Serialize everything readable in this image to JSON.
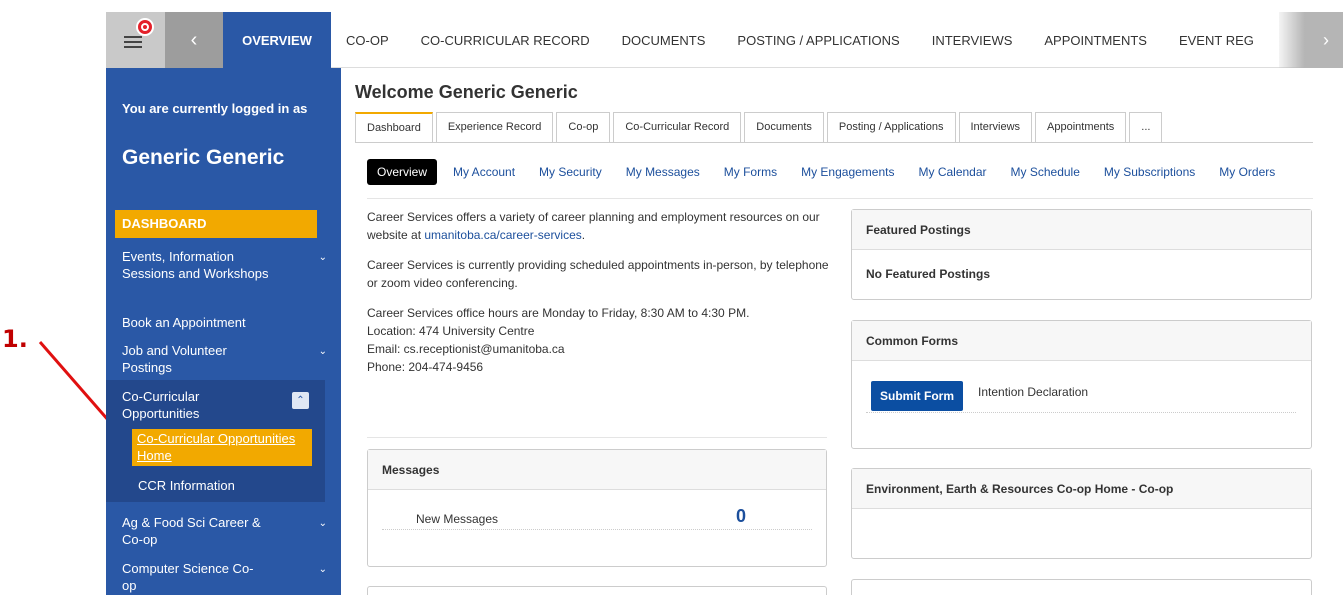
{
  "annotation": {
    "label": "1."
  },
  "topbar": {
    "overview_label": "OVERVIEW",
    "back_glyph": "‹",
    "next_glyph": "›",
    "items": [
      "CO-OP",
      "CO-CURRICULAR RECORD",
      "DOCUMENTS",
      "POSTING / APPLICATIONS",
      "INTERVIEWS",
      "APPOINTMENTS",
      "EVENT REG"
    ]
  },
  "sidebar": {
    "logged_in_text": "You are currently logged in as",
    "user_name": "Generic Generic",
    "dashboard_label": "DASHBOARD",
    "items": [
      "Events, Information Sessions and Workshops",
      "Book an Appointment",
      "Job and Volunteer Postings",
      "Co-Curricular Opportunities",
      "Ag & Food Sci Career & Co-op",
      "Computer Science Co-op"
    ],
    "sub_items": [
      "Co-Curricular Opportunities Home",
      "CCR Information"
    ]
  },
  "main": {
    "welcome": "Welcome Generic Generic",
    "tabs": [
      "Dashboard",
      "Experience Record",
      "Co-op",
      "Co-Curricular Record",
      "Documents",
      "Posting / Applications",
      "Interviews",
      "Appointments",
      "..."
    ],
    "subtabs": [
      "Overview",
      "My Account",
      "My Security",
      "My Messages",
      "My Forms",
      "My Engagements",
      "My Calendar",
      "My Schedule",
      "My Subscriptions",
      "My Orders"
    ],
    "intro": {
      "p1_text": "Career Services offers a variety of career planning and employment resources on our website at ",
      "p1_link": "umanitoba.ca/career-services",
      "p1_end": ".",
      "p2": "Career Services is currently providing scheduled appointments in-person, by telephone or zoom video conferencing.",
      "p3_hours": "Career Services office hours are Monday to Friday, 8:30 AM to 4:30 PM.",
      "p3_location": "Location: 474 University Centre",
      "p3_email": "Email: cs.receptionist@umanitoba.ca",
      "p3_phone": "Phone: 204-474-9456"
    },
    "messages": {
      "title": "Messages",
      "row_label": "New Messages",
      "count": "0"
    },
    "featured": {
      "title": "Featured Postings",
      "body": "No Featured Postings"
    },
    "common_forms": {
      "title": "Common Forms",
      "button": "Submit Form",
      "form_name": "Intention Declaration"
    },
    "coop_home": {
      "title": "Environment, Earth & Resources Co-op Home - Co-op"
    }
  }
}
